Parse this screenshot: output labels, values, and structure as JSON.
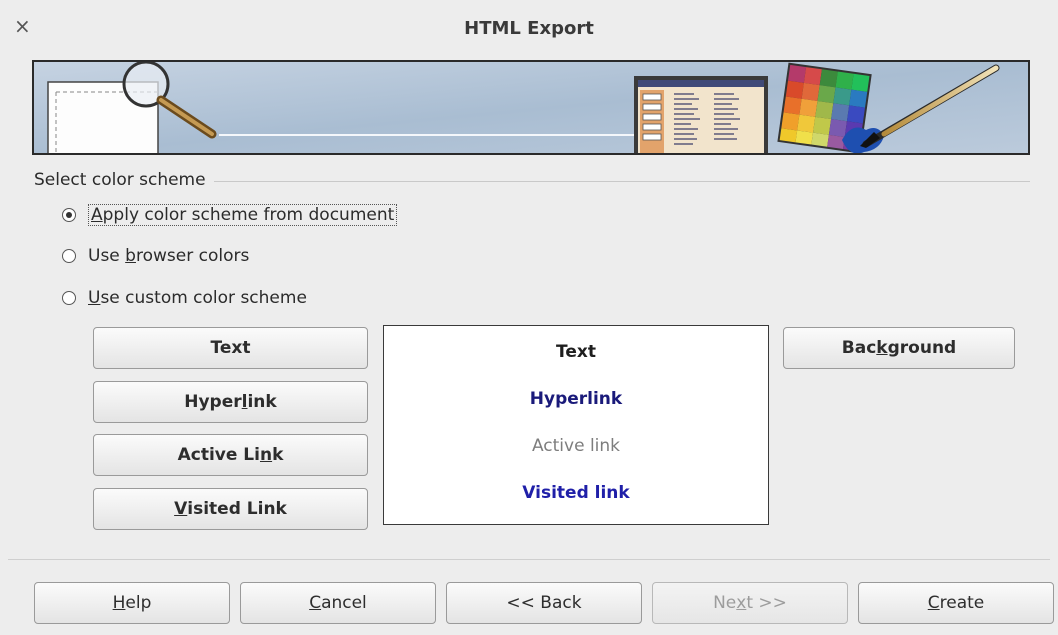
{
  "window": {
    "title": "HTML Export",
    "close_glyph": "×"
  },
  "section": {
    "label": "Select color scheme"
  },
  "radios": [
    {
      "pre": "",
      "mnemonic": "A",
      "post": "pply color scheme from document",
      "checked": true
    },
    {
      "pre": "Use ",
      "mnemonic": "b",
      "post": "rowser colors",
      "checked": false
    },
    {
      "pre": "",
      "mnemonic": "U",
      "post": "se custom color scheme",
      "checked": false
    }
  ],
  "color_buttons": {
    "text": {
      "pre": "Text",
      "mnemonic": "",
      "post": ""
    },
    "hyperlink": {
      "pre": "Hyper",
      "mnemonic": "l",
      "post": "ink"
    },
    "active_link": {
      "pre": "Active Li",
      "mnemonic": "n",
      "post": "k"
    },
    "visited_link": {
      "pre": "",
      "mnemonic": "V",
      "post": "isited Link"
    },
    "background": {
      "pre": "Bac",
      "mnemonic": "k",
      "post": "ground"
    }
  },
  "preview": {
    "text": "Text",
    "hyperlink": "Hyperlink",
    "active_link": "Active link",
    "visited_link": "Visited link",
    "colors": {
      "text": "#1e1e1e",
      "hyperlink": "#1a1a7a",
      "active_link": "#7d7d7d",
      "visited_link": "#1f1fa8"
    }
  },
  "footer": {
    "help": {
      "pre": "",
      "mnemonic": "H",
      "post": "elp"
    },
    "cancel": {
      "pre": "",
      "mnemonic": "C",
      "post": "ancel"
    },
    "back": {
      "pre": "<< Back",
      "mnemonic": "",
      "post": ""
    },
    "next": {
      "pre": "Ne",
      "mnemonic": "x",
      "post": "t >>",
      "disabled": true
    },
    "create": {
      "pre": "",
      "mnemonic": "C",
      "post": "reate"
    }
  }
}
